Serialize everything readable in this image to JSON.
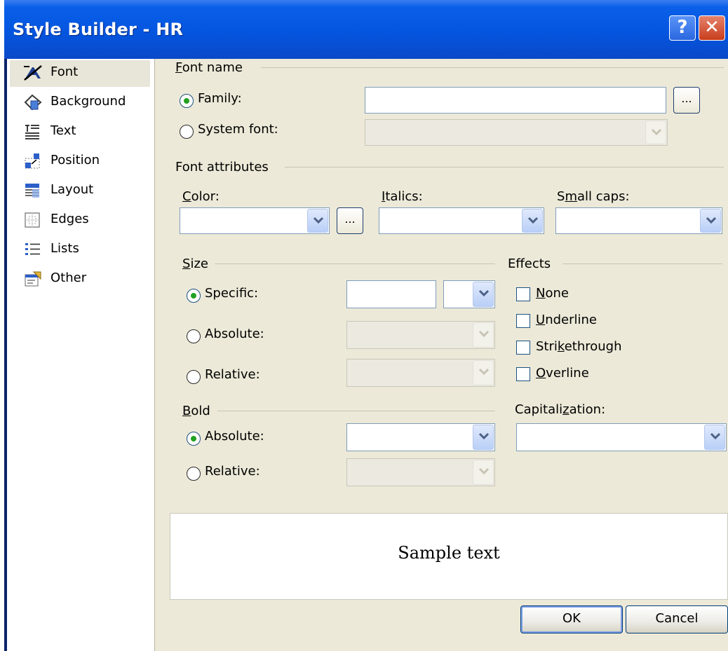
{
  "window": {
    "title": "Style Builder - HR",
    "help_glyph": "?",
    "close_glyph": "✕"
  },
  "sidebar": {
    "items": [
      {
        "label": "Font",
        "icon": "font-category-icon",
        "selected": true
      },
      {
        "label": "Background",
        "icon": "background-category-icon",
        "selected": false
      },
      {
        "label": "Text",
        "icon": "text-category-icon",
        "selected": false
      },
      {
        "label": "Position",
        "icon": "position-category-icon",
        "selected": false
      },
      {
        "label": "Layout",
        "icon": "layout-category-icon",
        "selected": false
      },
      {
        "label": "Edges",
        "icon": "edges-category-icon",
        "selected": false
      },
      {
        "label": "Lists",
        "icon": "lists-category-icon",
        "selected": false
      },
      {
        "label": "Other",
        "icon": "other-category-icon",
        "selected": false
      }
    ]
  },
  "font_name": {
    "group_label": "Font name",
    "family_label": "Family:",
    "family_value": "",
    "system_font_label": "System font:",
    "system_font_value": "",
    "family_selected": true,
    "ellipsis": "..."
  },
  "font_attributes": {
    "group_label": "Font attributes",
    "color_label": "Color:",
    "color_value": "",
    "italics_label": "Italics:",
    "italics_value": "",
    "small_caps_label": "Small caps:",
    "small_caps_value": "",
    "ellipsis": "..."
  },
  "size": {
    "group_label": "Size",
    "specific_label": "Specific:",
    "specific_value": "",
    "specific_unit": "",
    "absolute_label": "Absolute:",
    "relative_label": "Relative:",
    "selected": "Specific"
  },
  "effects": {
    "group_label": "Effects",
    "none_label": "None",
    "underline_label": "Underline",
    "strikethrough_label": "Strikethrough",
    "overline_label": "Overline",
    "checked": []
  },
  "bold": {
    "group_label": "Bold",
    "absolute_label": "Absolute:",
    "absolute_value": "",
    "relative_label": "Relative:",
    "selected": "Absolute"
  },
  "capitalization": {
    "label": "Capitalization:",
    "value": ""
  },
  "preview": {
    "text": "Sample text"
  },
  "buttons": {
    "ok": "OK",
    "cancel": "Cancel"
  },
  "colors": {
    "titlebar": "#0455df",
    "dialog_bg": "#ece9d8",
    "radio_selected": "#21a121",
    "input_border": "#7f9db9"
  }
}
